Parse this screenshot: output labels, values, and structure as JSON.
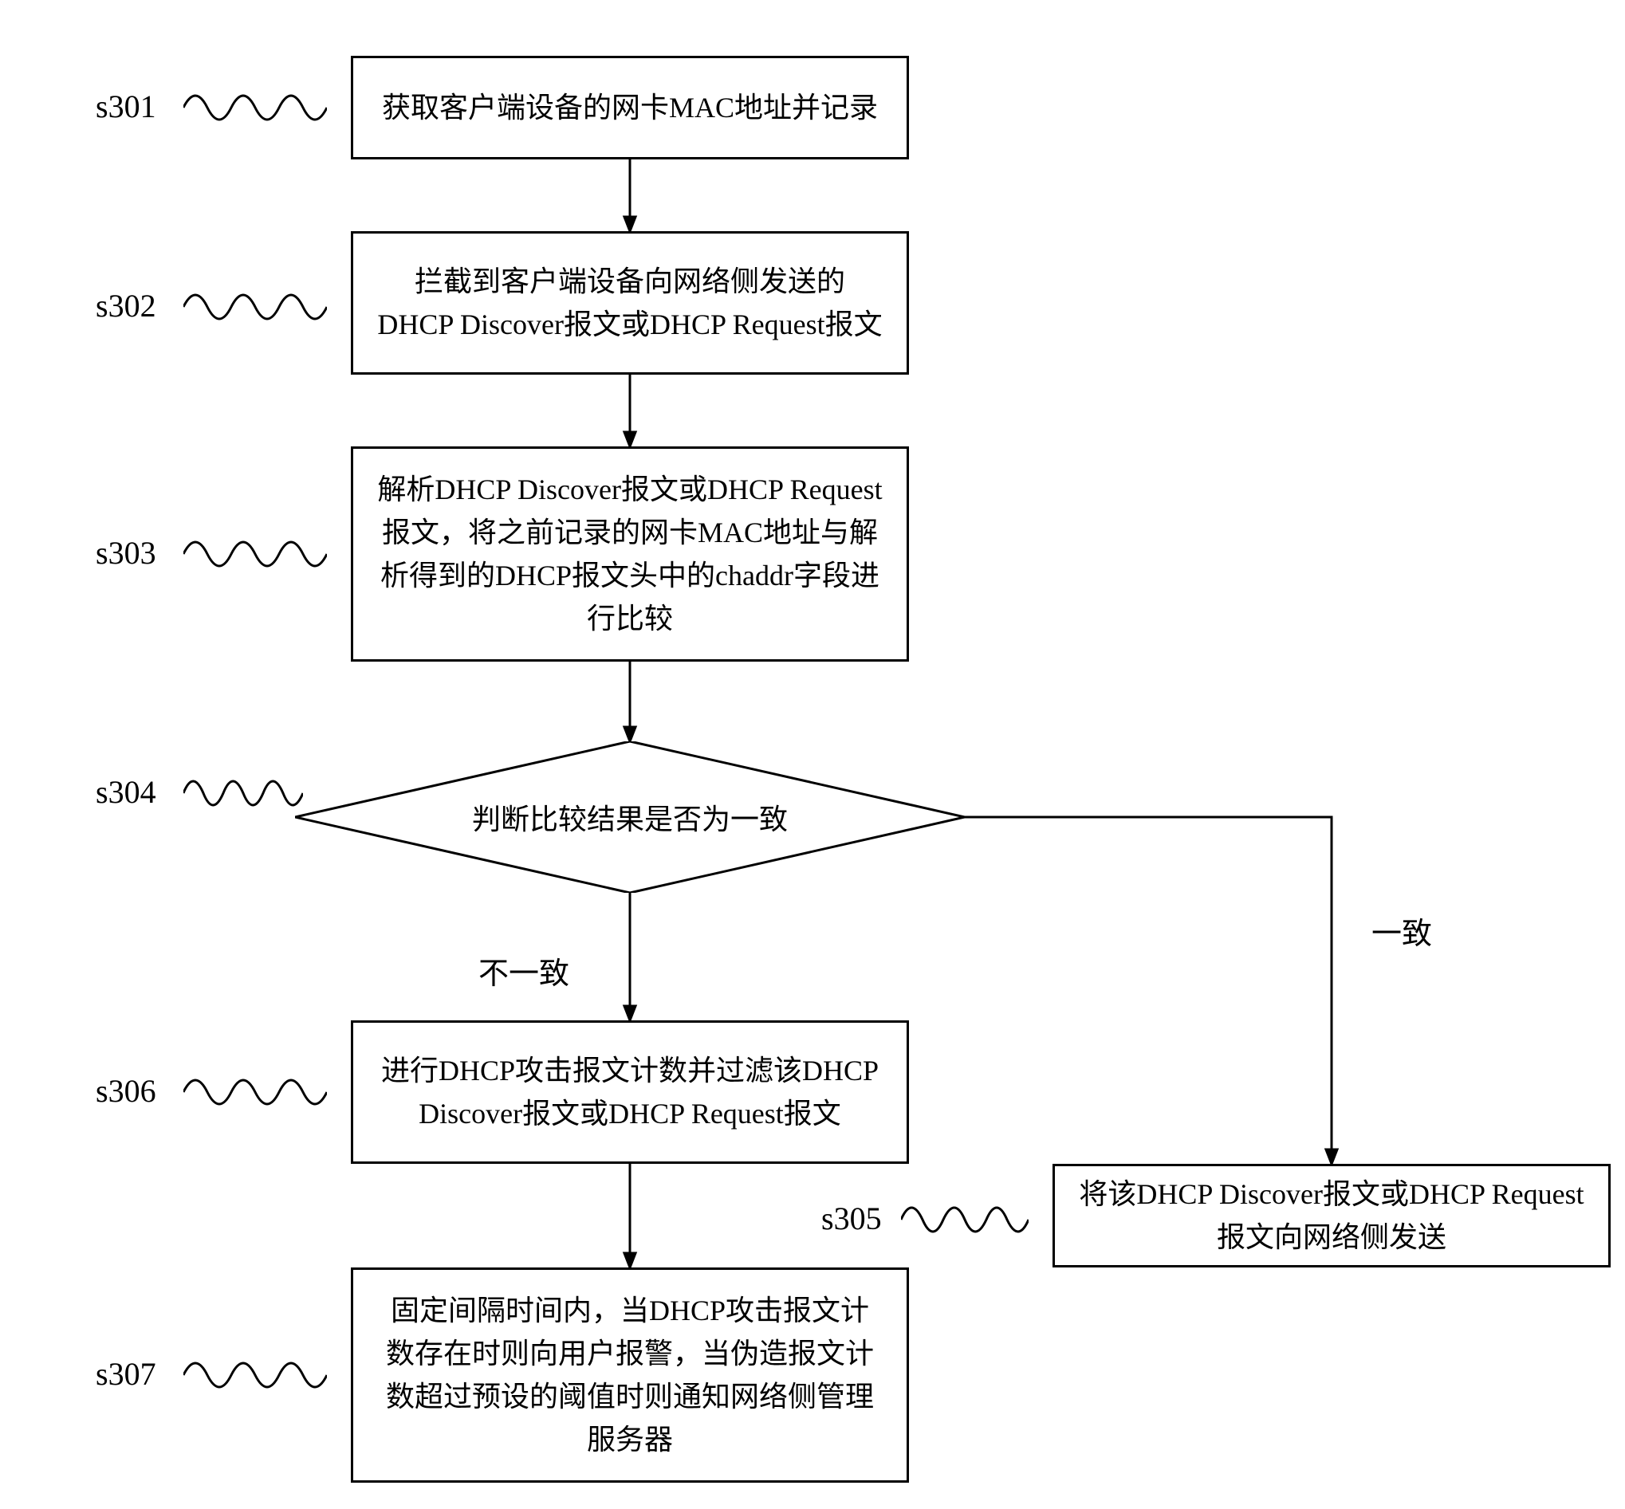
{
  "s301": {
    "label": "s301",
    "text": "获取客户端设备的网卡MAC地址并记录"
  },
  "s302": {
    "label": "s302",
    "text": "拦截到客户端设备向网络侧发送的DHCP Discover报文或DHCP Request报文"
  },
  "s303": {
    "label": "s303",
    "text": "解析DHCP Discover报文或DHCP Request报文，将之前记录的网卡MAC地址与解析得到的DHCP报文头中的chaddr字段进行比较"
  },
  "s304": {
    "label": "s304",
    "text": "判断比较结果是否为一致"
  },
  "s305": {
    "label": "s305",
    "text": "将该DHCP Discover报文或DHCP Request报文向网络侧发送"
  },
  "s306": {
    "label": "s306",
    "text": "进行DHCP攻击报文计数并过滤该DHCP Discover报文或DHCP Request报文"
  },
  "s307": {
    "label": "s307",
    "text": "固定间隔时间内，当DHCP攻击报文计数存在时则向用户报警，当伪造报文计数超过预设的阈值时则通知网络侧管理服务器"
  },
  "branches": {
    "no": "不一致",
    "yes": "一致"
  }
}
